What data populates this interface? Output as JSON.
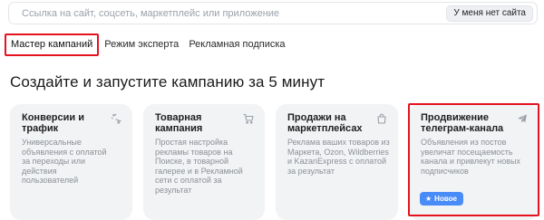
{
  "site_input": {
    "placeholder": "Ссылка на сайт, соцсеть, маркетплейс или приложение",
    "no_site_button": "У меня нет сайта"
  },
  "tabs": [
    {
      "label": "Мастер кампаний",
      "active": true
    },
    {
      "label": "Режим эксперта",
      "active": false
    },
    {
      "label": "Рекламная подписка",
      "active": false
    }
  ],
  "heading": "Создайте и запустите кампанию за 5 минут",
  "cards": [
    {
      "title": "Конверсии и трафик",
      "description": "Универсальные объявления с оплатой за переходы или действия пользователей",
      "icon": "sparkle-cursor-icon"
    },
    {
      "title": "Товарная кампания",
      "description": "Простая настройка рекламы товаров на Поиске, в товарной галерее и в Рекламной сети с оплатой за результат",
      "icon": "shopping-cart-icon"
    },
    {
      "title": "Продажи на маркетплейсах",
      "description": "Реклама ваших товаров из Маркета, Ozon, Wildberries и KazanExpress с оплатой за результат",
      "icon": "shopping-bag-icon"
    },
    {
      "title": "Продвижение телеграм-канала",
      "description": "Объявления из постов увеличат посещаемость канала и привлекут новых подписчиков",
      "icon": "telegram-plane-icon",
      "badge": "Новое",
      "highlighted": true
    }
  ],
  "colors": {
    "highlight_outline": "#e5121f",
    "badge_blue": "#4a8cf7",
    "card_background": "#f2f3f5"
  }
}
